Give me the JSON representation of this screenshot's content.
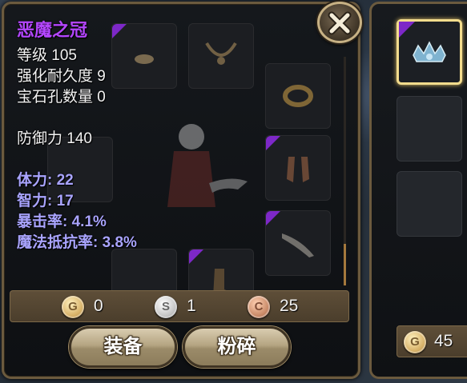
{
  "item": {
    "name": "恶魔之冠",
    "level": "等级 105",
    "durability": "强化耐久度 9",
    "gem_slots": "宝石孔数量 0",
    "defense": "防御力 140",
    "bonuses": [
      "体力: 22",
      "智力: 17",
      "暴击率: 4.1%",
      "魔法抵抗率: 3.8%"
    ]
  },
  "currency": {
    "gold": "0",
    "silver": "1",
    "copper": "25",
    "coin_letters": {
      "gold": "G",
      "silver": "S",
      "copper": "C"
    }
  },
  "actions": {
    "equip_label": "装备",
    "smash_label": "粉碎"
  },
  "inventory": {
    "gold": "45"
  },
  "colors": {
    "item_name": "#b446ff",
    "bonus_stat": "#a9a4ff",
    "rare_corner": "#7d28c8",
    "panel_border": "#6b5a3e",
    "selected_border": "#f3dc8d"
  },
  "icons": [
    "close-icon",
    "gold-coin-icon",
    "silver-coin-icon",
    "copper-coin-icon",
    "crown-icon",
    "ring-icon",
    "necklace-icon",
    "gloves-icon",
    "dagger-icon"
  ]
}
